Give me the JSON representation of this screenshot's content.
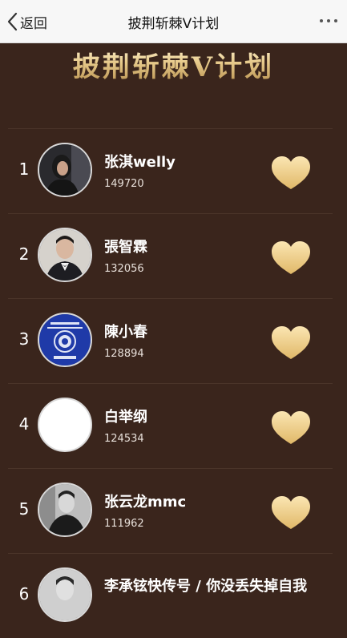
{
  "nav": {
    "back_label": "返回",
    "title": "披荆斩棘V计划"
  },
  "banner": {
    "title": "披荆斩棘V计划"
  },
  "colors": {
    "gold": "#e6c98a",
    "background": "#3a251c"
  },
  "ranking": [
    {
      "rank": "1",
      "name": "张淇welly",
      "score": "149720",
      "avatar": "photo-dark"
    },
    {
      "rank": "2",
      "name": "張智霖",
      "score": "132056",
      "avatar": "photo-suit"
    },
    {
      "rank": "3",
      "name": "陳小春",
      "score": "128894",
      "avatar": "hk-passport-emblem"
    },
    {
      "rank": "4",
      "name": "白举纲",
      "score": "124534",
      "avatar": "blank-white"
    },
    {
      "rank": "5",
      "name": "张云龙mmc",
      "score": "111962",
      "avatar": "photo-bw"
    },
    {
      "rank": "6",
      "name": "李承铉快传号 / 你没丢失掉自我",
      "score": "",
      "avatar": "photo-bw"
    }
  ]
}
